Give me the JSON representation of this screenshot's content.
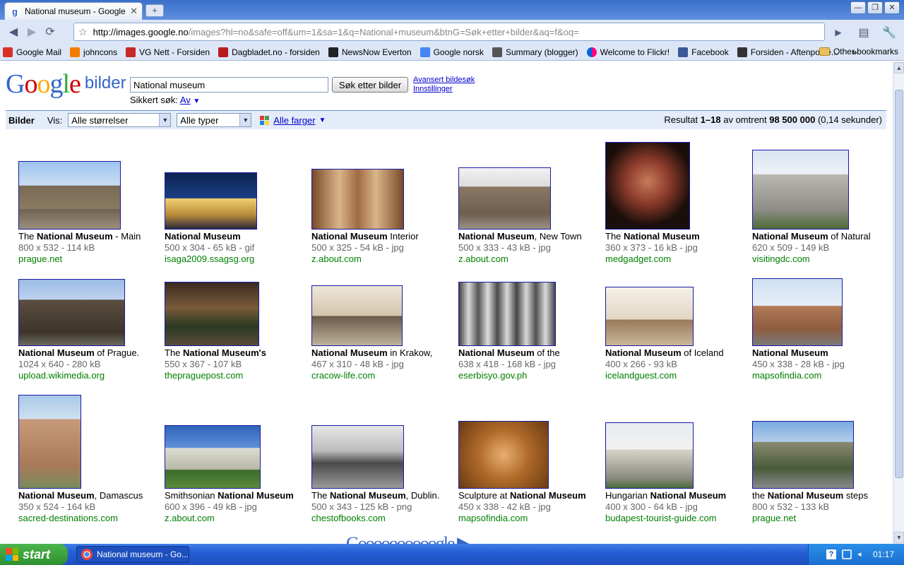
{
  "browser": {
    "tab_title": "National museum - Google ...",
    "tab_close": "✕",
    "new_tab": "+",
    "window_buttons": [
      "—",
      "❐",
      "✕"
    ],
    "url_host": "http://images.google.no",
    "url_path": "/images?hl=no&safe=off&um=1&sa=1&q=National+museum&btnG=Søk+etter+bilder&aq=f&oq=",
    "bookmarks": [
      {
        "label": "Google Mail",
        "color": "#d93025"
      },
      {
        "label": "johncons",
        "color": "#f57c00"
      },
      {
        "label": "VG Nett - Forsiden",
        "color": "#c62828"
      },
      {
        "label": "Dagbladet.no - forsiden",
        "color": "#b71c1c"
      },
      {
        "label": "NewsNow Everton",
        "color": "#222222"
      },
      {
        "label": "Google norsk",
        "color": "#4285f4"
      },
      {
        "label": "Summary (blogger)",
        "color": "#555555"
      },
      {
        "label": "Welcome to Flickr!",
        "color": "#ff0084"
      },
      {
        "label": "Facebook",
        "color": "#3b5998"
      },
      {
        "label": "Forsiden - Aftenposte...",
        "color": "#333333"
      }
    ],
    "bookmarks_more": "»",
    "other_bookmarks": "Other bookmarks"
  },
  "header": {
    "logo": "Google",
    "logo_suffix": "bilder",
    "search_value": "National museum",
    "search_button": "Søk etter bilder",
    "advanced_search": "Avansert bildesøk",
    "settings": "Innstillinger",
    "safe_label": "Sikkert søk:",
    "safe_value": "Av",
    "safe_arrow": "▼"
  },
  "filters": {
    "bilder": "Bilder",
    "vis": "Vis:",
    "size": "Alle størrelser",
    "type": "Alle typer",
    "colors": "Alle farger",
    "colors_arrow": "▼",
    "results_prefix": "Resultat ",
    "results_range": "1–18",
    "results_mid": " av omtrent ",
    "results_count": "98 500 000",
    "results_time": " (0,14 sekunder)"
  },
  "results": [
    {
      "pre": "The ",
      "bold": "National Museum",
      "post": " - Main",
      "meta": "800 x 532 - 114 kB",
      "site": "prague.net"
    },
    {
      "pre": "",
      "bold": "National Museum",
      "post": "",
      "meta": "500 x 304 - 65 kB - gif",
      "site": "isaga2009.ssagsg.org"
    },
    {
      "pre": "",
      "bold": "National Museum",
      "post": " Interior",
      "meta": "500 x 325 - 54 kB - jpg",
      "site": "z.about.com"
    },
    {
      "pre": "",
      "bold": "National Museum",
      "post": ", New Town",
      "meta": "500 x 333 - 43 kB - jpg",
      "site": "z.about.com"
    },
    {
      "pre": "The ",
      "bold": "National Museum",
      "post": "",
      "meta": "360 x 373 - 16 kB - jpg",
      "site": "medgadget.com"
    },
    {
      "pre": "",
      "bold": "National Museum",
      "post": " of Natural",
      "meta": "620 x 509 - 149 kB",
      "site": "visitingdc.com"
    },
    {
      "pre": "",
      "bold": "National Museum",
      "post": " of Prague.",
      "meta": "1024 x 640 - 280 kB",
      "site": "upload.wikimedia.org"
    },
    {
      "pre": "The ",
      "bold": "National Museum's",
      "post": "",
      "meta": "550 x 367 - 107 kB",
      "site": "thepraguepost.com"
    },
    {
      "pre": "",
      "bold": "National Museum",
      "post": " in Krakow,",
      "meta": "467 x 310 - 48 kB - jpg",
      "site": "cracow-life.com"
    },
    {
      "pre": "",
      "bold": "National Museum",
      "post": " of the",
      "meta": "638 x 418 - 168 kB - jpg",
      "site": "eserbisyo.gov.ph"
    },
    {
      "pre": "",
      "bold": "National Museum",
      "post": " of Iceland",
      "meta": "400 x 266 - 93 kB",
      "site": "icelandguest.com"
    },
    {
      "pre": "",
      "bold": "National Museum",
      "post": "",
      "meta": "450 x 338 - 28 kB - jpg",
      "site": "mapsofindia.com"
    },
    {
      "pre": "",
      "bold": "National Museum",
      "post": ", Damascus",
      "meta": "350 x 524 - 164 kB",
      "site": "sacred-destinations.com"
    },
    {
      "pre": "Smithsonian ",
      "bold": "National Museum",
      "post": "",
      "meta": "600 x 396 - 49 kB - jpg",
      "site": "z.about.com"
    },
    {
      "pre": "The ",
      "bold": "National Museum",
      "post": ", Dublin.",
      "meta": "500 x 343 - 125 kB - png",
      "site": "chestofbooks.com"
    },
    {
      "pre": "Sculpture at ",
      "bold": "National Museum",
      "post": "",
      "meta": "450 x 338 - 42 kB - jpg",
      "site": "mapsofindia.com"
    },
    {
      "pre": "Hungarian ",
      "bold": "National Museum",
      "post": "",
      "meta": "400 x 300 - 64 kB - jpg",
      "site": "budapest-tourist-guide.com"
    },
    {
      "pre": "the ",
      "bold": "National Museum",
      "post": " steps",
      "meta": "800 x 532 - 133 kB",
      "site": "prague.net"
    }
  ],
  "pager": "Goooooooooogle ▶",
  "taskbar": {
    "start": "start",
    "task": "National museum - Go...",
    "clock": "01:17"
  }
}
